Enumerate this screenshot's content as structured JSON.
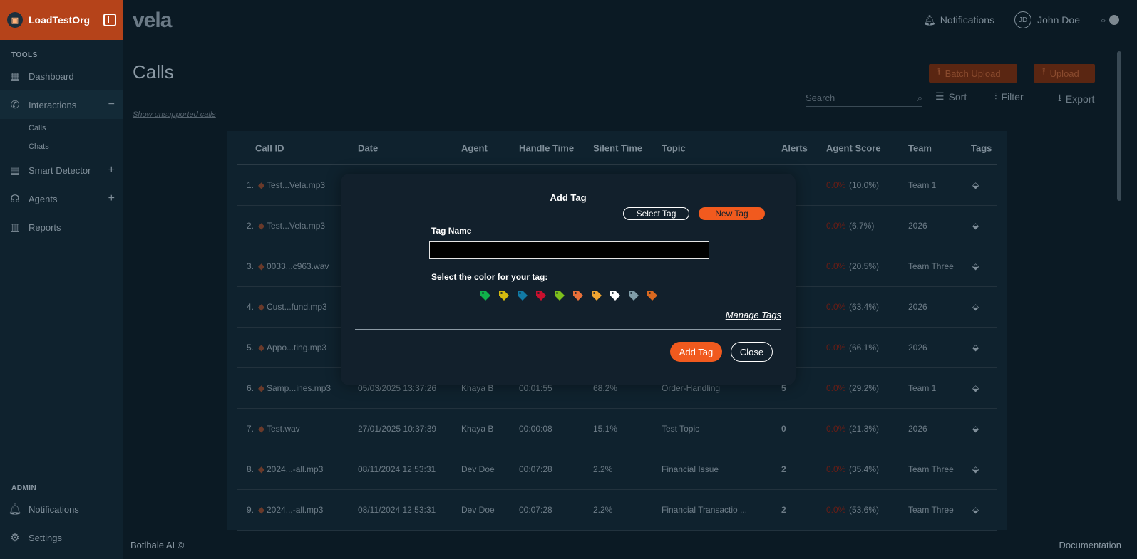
{
  "org": {
    "name": "LoadTestOrg"
  },
  "brand": {
    "logo_text": "vela"
  },
  "sidebar": {
    "tools_label": "TOOLS",
    "items": [
      {
        "label": "Dashboard"
      },
      {
        "label": "Interactions"
      },
      {
        "label": "Smart Detector"
      },
      {
        "label": "Agents"
      },
      {
        "label": "Reports"
      }
    ],
    "sub_items": [
      {
        "label": "Calls"
      },
      {
        "label": "Chats"
      }
    ],
    "admin_label": "ADMIN",
    "admin_items": [
      {
        "label": "Notifications"
      },
      {
        "label": "Settings"
      }
    ]
  },
  "header": {
    "notifications": "Notifications",
    "user_initials": "JD",
    "user_name": "John Doe"
  },
  "page": {
    "title": "Calls",
    "unsupported_link": "Show unsupported calls",
    "batch_upload": "Batch Upload",
    "upload": "Upload",
    "search_placeholder": "Search",
    "sort": "Sort",
    "filter": "Filter",
    "export": "Export"
  },
  "table": {
    "columns": [
      "Call ID",
      "Date",
      "Agent",
      "Handle Time",
      "Silent Time",
      "Topic",
      "Alerts",
      "Agent Score",
      "Team",
      "Tags"
    ],
    "rows": [
      {
        "num": "1.",
        "id": "Test...Vela.mp3",
        "date": "",
        "agent": "",
        "handle": "",
        "silent": "",
        "topic": "",
        "alerts": "",
        "score": "0.0%",
        "score_pct": "(10.0%)",
        "team": "Team 1"
      },
      {
        "num": "2.",
        "id": "Test...Vela.mp3",
        "date": "",
        "agent": "",
        "handle": "",
        "silent": "",
        "topic": "",
        "alerts": "",
        "score": "0.0%",
        "score_pct": "(6.7%)",
        "team": "2026"
      },
      {
        "num": "3.",
        "id": "0033...c963.wav",
        "date": "",
        "agent": "",
        "handle": "",
        "silent": "",
        "topic": "",
        "alerts": "",
        "score": "0.0%",
        "score_pct": "(20.5%)",
        "team": "Team Three"
      },
      {
        "num": "4.",
        "id": "Cust...fund.mp3",
        "date": "",
        "agent": "",
        "handle": "",
        "silent": "",
        "topic": "",
        "alerts": "",
        "score": "0.0%",
        "score_pct": "(63.4%)",
        "team": "2026"
      },
      {
        "num": "5.",
        "id": "Appo...ting.mp3",
        "date": "",
        "agent": "",
        "handle": "",
        "silent": "",
        "topic": "",
        "alerts": "",
        "score": "0.0%",
        "score_pct": "(66.1%)",
        "team": "2026"
      },
      {
        "num": "6.",
        "id": "Samp...ines.mp3",
        "date": "05/03/2025 13:37:26",
        "agent": "Khaya B",
        "handle": "00:01:55",
        "silent": "68.2%",
        "topic": "Order-Handling",
        "alerts": "5",
        "score": "0.0%",
        "score_pct": "(29.2%)",
        "team": "Team 1"
      },
      {
        "num": "7.",
        "id": "Test.wav",
        "date": "27/01/2025 10:37:39",
        "agent": "Khaya B",
        "handle": "00:00:08",
        "silent": "15.1%",
        "topic": "Test Topic",
        "alerts": "0",
        "score": "0.0%",
        "score_pct": "(21.3%)",
        "team": "2026"
      },
      {
        "num": "8.",
        "id": "2024...-all.mp3",
        "date": "08/11/2024 12:53:31",
        "agent": "Dev Doe",
        "handle": "00:07:28",
        "silent": "2.2%",
        "topic": "Financial Issue",
        "alerts": "2",
        "score": "0.0%",
        "score_pct": "(35.4%)",
        "team": "Team Three"
      },
      {
        "num": "9.",
        "id": "2024...-all.mp3",
        "date": "08/11/2024 12:53:31",
        "agent": "Dev Doe",
        "handle": "00:07:28",
        "silent": "2.2%",
        "topic": "Financial Transactio ...",
        "alerts": "2",
        "score": "0.0%",
        "score_pct": "(53.6%)",
        "team": "Team Three"
      }
    ]
  },
  "modal": {
    "title": "Add Tag",
    "select_tag": "Select Tag",
    "new_tag": "New Tag",
    "tag_name_label": "Tag Name",
    "tag_name_value": "",
    "color_label": "Select the color for your tag:",
    "colors": [
      "#10b24a",
      "#d4b90f",
      "#117aa5",
      "#c8102e",
      "#7dbf1c",
      "#e8703a",
      "#f0a531",
      "#ffffff",
      "#7f9ca8",
      "#d9681f"
    ],
    "manage_tags": "Manage Tags",
    "add_button": "Add Tag",
    "close_button": "Close"
  },
  "footer": {
    "left": "Botlhale AI ©",
    "right": "Documentation"
  }
}
